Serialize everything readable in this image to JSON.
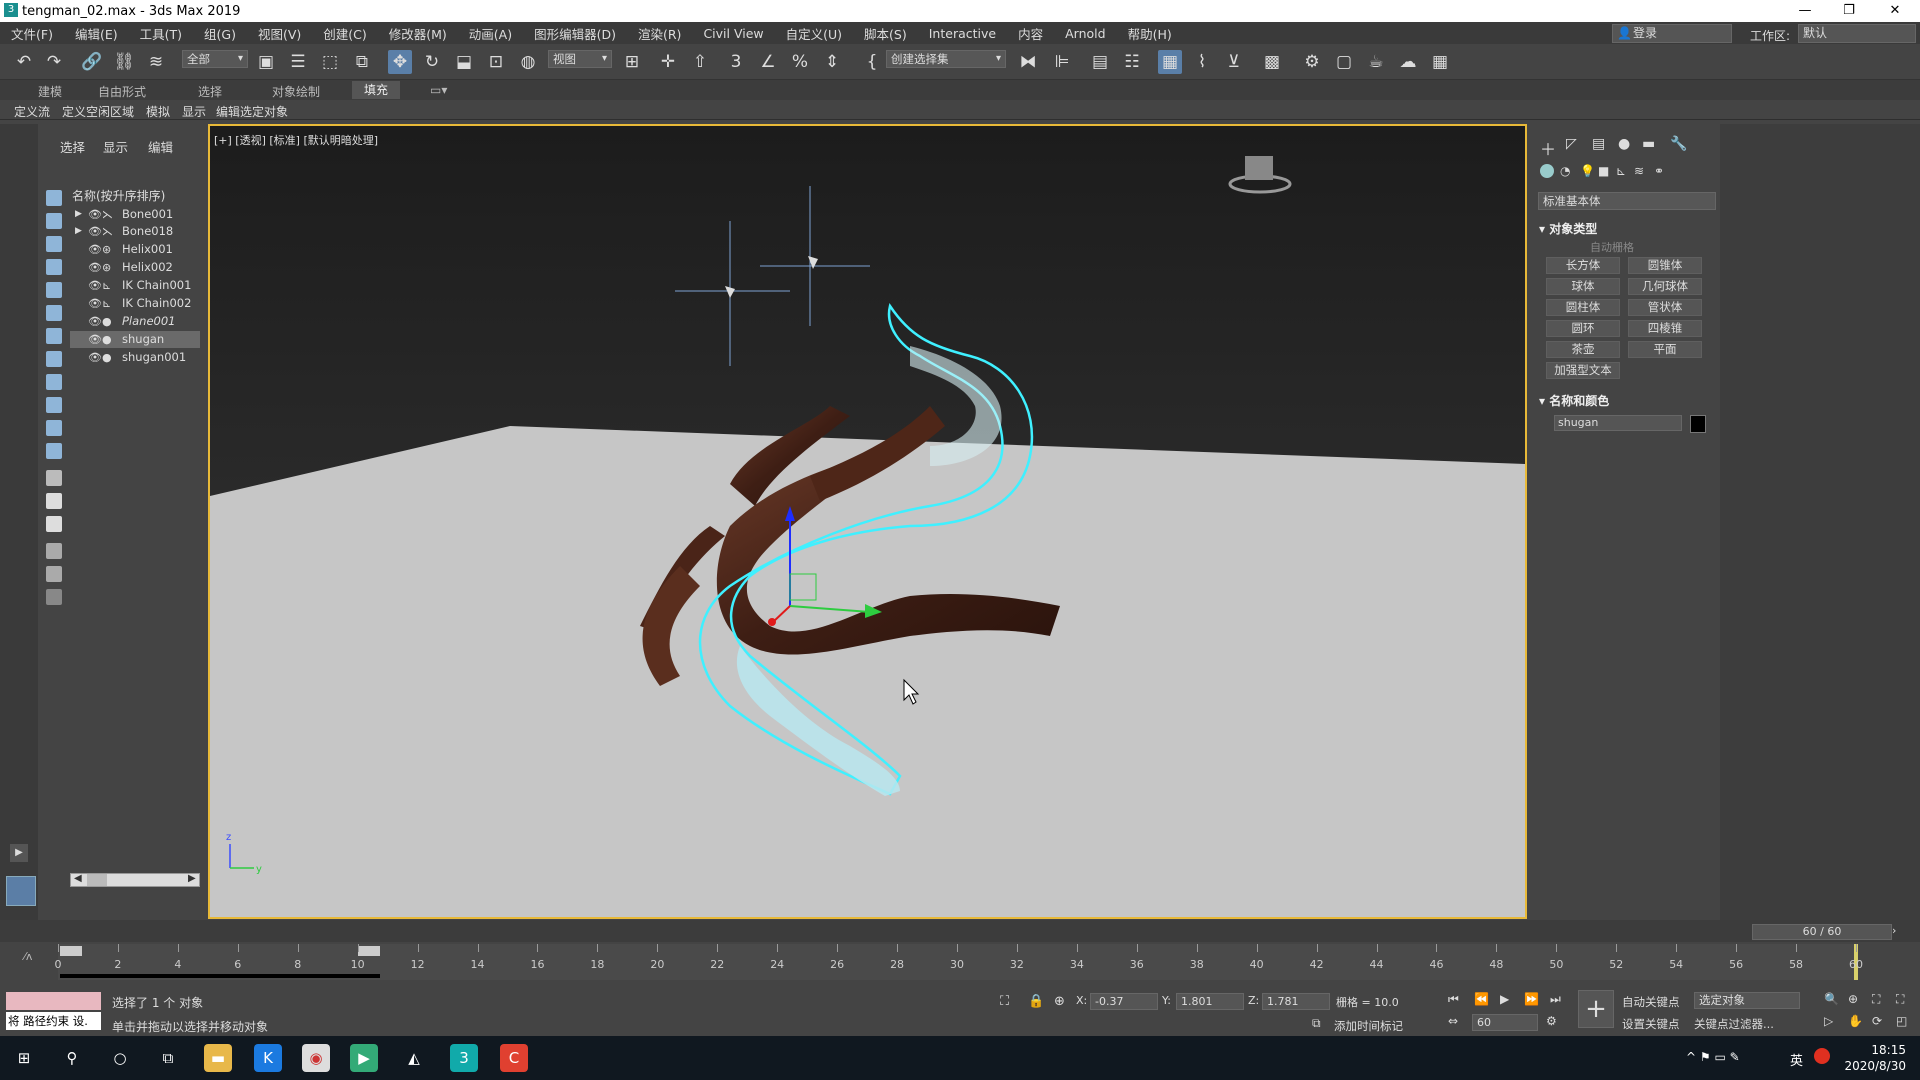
{
  "window": {
    "title": "tengman_02.max - 3ds Max 2019",
    "controls": [
      "—",
      "❐",
      "✕"
    ]
  },
  "menu": [
    "文件(F)",
    "编辑(E)",
    "工具(T)",
    "组(G)",
    "视图(V)",
    "创建(C)",
    "修改器(M)",
    "动画(A)",
    "图形编辑器(D)",
    "渲染(R)",
    "Civil View",
    "自定义(U)",
    "脚本(S)",
    "Interactive",
    "内容",
    "Arnold",
    "帮助(H)"
  ],
  "account": {
    "login": "登录",
    "workspace_label": "工作区:",
    "workspace": "默认"
  },
  "toolbar": {
    "filter": "全部",
    "ref_coord": "视图",
    "selection_set": "创建选择集"
  },
  "ribbon": {
    "tabs": [
      "建模",
      "自由形式",
      "选择",
      "对象绘制",
      "填充"
    ],
    "active": "填充",
    "sub": [
      "定义流",
      "定义空闲区域",
      "模拟",
      "显示",
      "编辑选定对象"
    ]
  },
  "explorer": {
    "tabs": [
      "选择",
      "显示",
      "编辑"
    ],
    "header": "名称(按升序排序)",
    "items": [
      {
        "name": "Bone001",
        "expand": "▶",
        "icon": "⋋",
        "selected": false
      },
      {
        "name": "Bone018",
        "expand": "▶",
        "icon": "⋋",
        "selected": false
      },
      {
        "name": "Helix001",
        "expand": "",
        "icon": "⊛",
        "selected": false
      },
      {
        "name": "Helix002",
        "expand": "",
        "icon": "⊛",
        "selected": false
      },
      {
        "name": "IK Chain001",
        "expand": "",
        "icon": "⊾",
        "selected": false
      },
      {
        "name": "IK Chain002",
        "expand": "",
        "icon": "⊾",
        "selected": false
      },
      {
        "name": "Plane001",
        "expand": "",
        "icon": "●",
        "selected": false
      },
      {
        "name": "shugan",
        "expand": "",
        "icon": "●",
        "selected": true
      },
      {
        "name": "shugan001",
        "expand": "",
        "icon": "●",
        "selected": false
      }
    ]
  },
  "viewport": {
    "label": "[+] [透视] [标准] [默认明暗处理]",
    "axis_x": "y",
    "axis_z": "z"
  },
  "command_panel": {
    "category": "标准基本体",
    "object_type_title": "对象类型",
    "autogrid": "自动栅格",
    "buttons": [
      "长方体",
      "圆锥体",
      "球体",
      "几何球体",
      "圆柱体",
      "管状体",
      "圆环",
      "四棱锥",
      "茶壶",
      "平面",
      "加强型文本"
    ],
    "name_color_title": "名称和颜色",
    "object_name": "shugan"
  },
  "timeline": {
    "frame_counter": "60 / 60",
    "labels": [
      "0",
      "2",
      "4",
      "6",
      "8",
      "10",
      "12",
      "14",
      "16",
      "18",
      "20",
      "22",
      "24",
      "26",
      "28",
      "30",
      "32",
      "34",
      "36",
      "38",
      "40",
      "42",
      "44",
      "46",
      "48",
      "50",
      "52",
      "54",
      "56",
      "58",
      "60"
    ]
  },
  "status": {
    "script_box": "将 路径约束 设.",
    "selected": "选择了 1 个 对象",
    "prompt": "单击并拖动以选择并移动对象",
    "x_label": "X:",
    "x": "-0.37",
    "y_label": "Y:",
    "y": "1.801",
    "z_label": "Z:",
    "z": "1.781",
    "grid": "栅格 = 10.0",
    "add_time_tag": "添加时间标记",
    "auto_key": "自动关键点",
    "set_key": "设置关键点",
    "selected_object": "选定对象",
    "key_filter": "关键点过滤器...",
    "frame": "60"
  },
  "taskbar": {
    "time": "18:15",
    "date": "2020/8/30",
    "ime": "英"
  }
}
